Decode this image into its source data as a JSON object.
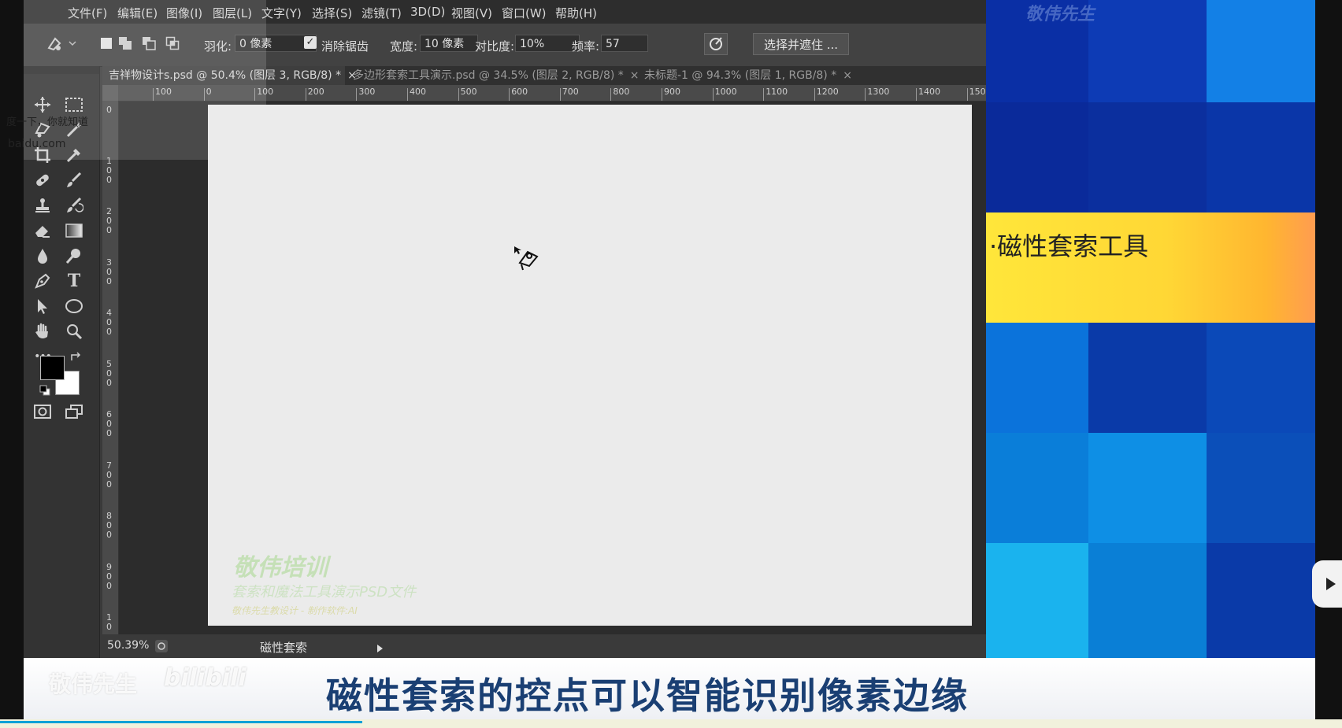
{
  "menu": [
    "文件(F)",
    "编辑(E)",
    "图像(I)",
    "图层(L)",
    "文字(Y)",
    "选择(S)",
    "滤镜(T)",
    "3D(D)",
    "视图(V)",
    "窗口(W)",
    "帮助(H)"
  ],
  "options": {
    "feather_label": "羽化:",
    "feather_value": "0 像素",
    "antialias_label": "消除锯齿",
    "antialias_checked": true,
    "width_label": "宽度:",
    "width_value": "10 像素",
    "contrast_label": "对比度:",
    "contrast_value": "10%",
    "frequency_label": "频率:",
    "frequency_value": "57",
    "select_mask_button": "选择并遮住 ..."
  },
  "tabs": [
    {
      "label": "吉祥物设计s.psd @ 50.4% (图层 3, RGB/8) *",
      "active": true
    },
    {
      "label": "多边形套索工具演示.psd @ 34.5% (图层 2, RGB/8) *",
      "active": false
    },
    {
      "label": "未标题-1 @ 94.3% (图层 1, RGB/8) *",
      "active": false
    }
  ],
  "tab_close": "×",
  "ruler_h": [
    "100",
    "0",
    "100",
    "200",
    "300",
    "400",
    "500",
    "600",
    "700",
    "800",
    "900",
    "1000",
    "1100",
    "1200",
    "1300",
    "1400",
    "1500"
  ],
  "ruler_v": [
    "0",
    "1\n0\n0",
    "2\n0\n0",
    "3\n0\n0",
    "4\n0\n0",
    "5\n0\n0",
    "6\n0\n0",
    "7\n0\n0",
    "8\n0\n0",
    "9\n0\n0",
    "1\n0"
  ],
  "tools": [
    "move-icon",
    "marquee-icon",
    "lasso-icon",
    "magic-wand-icon",
    "crop-icon",
    "eyedropper-icon",
    "healing-brush-icon",
    "brush-icon",
    "clone-stamp-icon",
    "history-brush-icon",
    "eraser-icon",
    "gradient-icon",
    "blur-icon",
    "dodge-icon",
    "pen-icon",
    "type-icon",
    "path-select-icon",
    "ellipse-icon",
    "hand-icon",
    "zoom-icon",
    "more-icon"
  ],
  "type_tool_glyph": "T",
  "more_tool_glyph": "•••",
  "colors": {
    "foreground": "#000000",
    "background": "#ffffff",
    "panel": "#3a3a3a",
    "accent_blue": "#0b2fa0",
    "subtitle_text": "#1a3f73"
  },
  "popup": {
    "line1": "度一下，你就知道",
    "line2": "baidu.com"
  },
  "status": {
    "zoom": "50.39%",
    "tool_name": "磁性套索"
  },
  "canvas_watermark": {
    "title": "敬伟培训",
    "line1": "套索和魔法工具演示PSD文件",
    "line2": "敬伟先生教设计 - 制作软件:AI"
  },
  "right_panel": {
    "watermark": "敬伟先生",
    "title": "·磁性套索工具"
  },
  "subtitle": "磁性套索的控点可以智能识别像素边缘",
  "bottom_watermark": {
    "name": "敬伟先生",
    "logo": "bilibili"
  }
}
